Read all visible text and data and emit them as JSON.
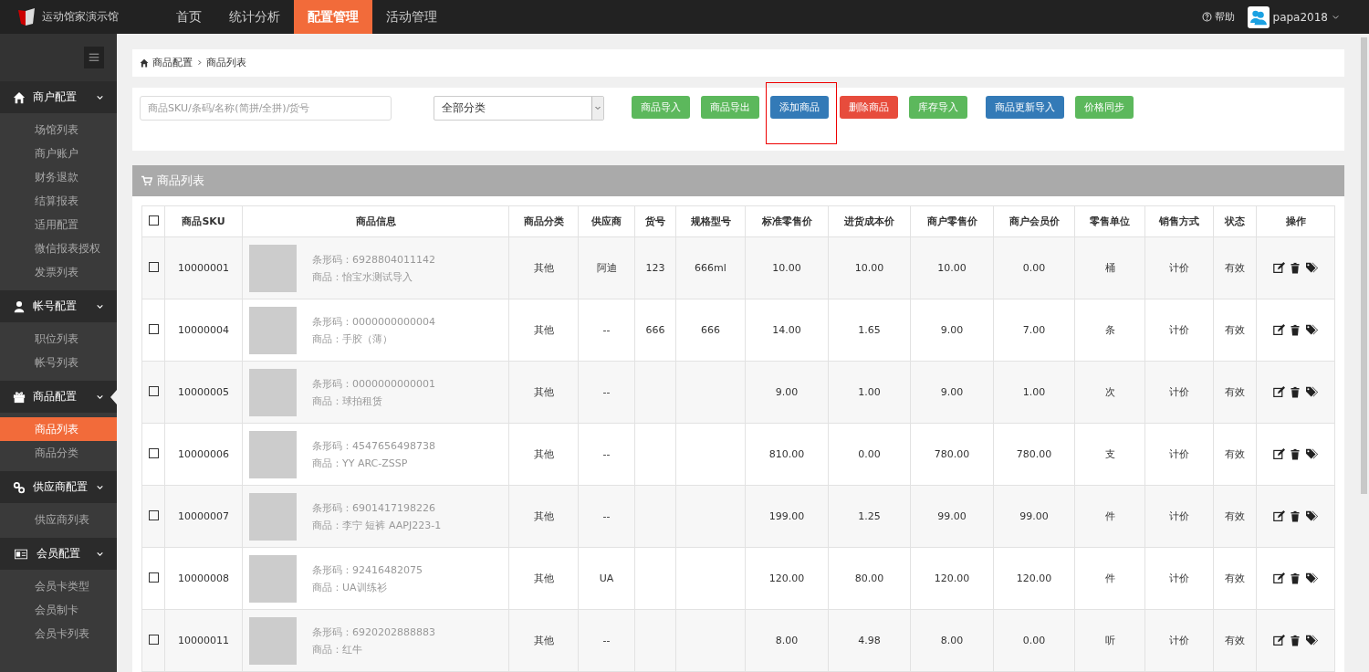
{
  "topbar": {
    "brand": "运动馆家演示馆",
    "nav": [
      {
        "label": "首页",
        "selected": false
      },
      {
        "label": "统计分析",
        "selected": false
      },
      {
        "label": "配置管理",
        "selected": true
      },
      {
        "label": "活动管理",
        "selected": false
      }
    ],
    "help": "帮助",
    "user": "papa2018"
  },
  "sidebar": {
    "groups": [
      {
        "label": "商户配置",
        "items": [
          {
            "label": "场馆列表",
            "selected": false
          },
          {
            "label": "商户账户",
            "selected": false
          },
          {
            "label": "财务退款",
            "selected": false
          },
          {
            "label": "结算报表",
            "selected": false
          },
          {
            "label": "适用配置",
            "selected": false
          },
          {
            "label": "微信报表授权",
            "selected": false
          },
          {
            "label": "发票列表",
            "selected": false
          }
        ]
      },
      {
        "label": "帐号配置",
        "items": [
          {
            "label": "职位列表",
            "selected": false
          },
          {
            "label": "帐号列表",
            "selected": false
          }
        ]
      },
      {
        "label": "商品配置",
        "items": [
          {
            "label": "商品列表",
            "selected": true
          },
          {
            "label": "商品分类",
            "selected": false
          }
        ]
      },
      {
        "label": "供应商配置",
        "items": [
          {
            "label": "供应商列表",
            "selected": false
          }
        ]
      },
      {
        "label": "会员配置",
        "items": [
          {
            "label": "会员卡类型",
            "selected": false
          },
          {
            "label": "会员制卡",
            "selected": false
          },
          {
            "label": "会员卡列表",
            "selected": false
          }
        ]
      }
    ]
  },
  "breadcrumb": [
    "商品配置",
    "商品列表"
  ],
  "toolbar": {
    "search": {
      "placeholder": "商品SKU/条码/名称(简拼/全拼)/货号"
    },
    "category_select": "全部分类",
    "buttons": [
      {
        "label": "商品导入",
        "kind": "success",
        "highlighted": false
      },
      {
        "label": "商品导出",
        "kind": "success",
        "highlighted": false
      },
      {
        "label": "添加商品",
        "kind": "primary",
        "highlighted": true
      },
      {
        "label": "删除商品",
        "kind": "danger",
        "highlighted": false
      },
      {
        "label": "库存导入",
        "kind": "success",
        "highlighted": false
      },
      {
        "label": "商品更新导入",
        "kind": "primary",
        "highlighted": false
      },
      {
        "label": "价格同步",
        "kind": "success",
        "highlighted": false
      }
    ]
  },
  "panel": {
    "title": "商品列表",
    "table": {
      "select_all_checked": false,
      "columns": [
        "商品SKU",
        "商品信息",
        "商品分类",
        "供应商",
        "货号",
        "规格型号",
        "标准零售价",
        "进货成本价",
        "商户零售价",
        "商户会员价",
        "零售单位",
        "销售方式",
        "状态",
        "操作"
      ],
      "rows": [
        {
          "checked": false,
          "sku": "10000001",
          "barcode": "条形码：6928804011142",
          "product": "商品：怡宝水测试导入",
          "category": "其他",
          "supplier": "阿迪",
          "item_no": "123",
          "spec": "666ml",
          "std_price": "10.00",
          "cost": "10.00",
          "retail": "10.00",
          "member": "0.00",
          "unit": "桶",
          "sale_mode": "计价",
          "status": "有效"
        },
        {
          "checked": false,
          "sku": "10000004",
          "barcode": "条形码：0000000000004",
          "product": "商品：手胶（薄）",
          "category": "其他",
          "supplier": "--",
          "item_no": "666",
          "spec": "666",
          "std_price": "14.00",
          "cost": "1.65",
          "retail": "9.00",
          "member": "7.00",
          "unit": "条",
          "sale_mode": "计价",
          "status": "有效"
        },
        {
          "checked": false,
          "sku": "10000005",
          "barcode": "条形码：0000000000001",
          "product": "商品：球拍租赁",
          "category": "其他",
          "supplier": "--",
          "item_no": "",
          "spec": "",
          "std_price": "9.00",
          "cost": "1.00",
          "retail": "9.00",
          "member": "1.00",
          "unit": "次",
          "sale_mode": "计价",
          "status": "有效"
        },
        {
          "checked": false,
          "sku": "10000006",
          "barcode": "条形码：4547656498738",
          "product": "商品：YY ARC-ZSSP",
          "category": "其他",
          "supplier": "--",
          "item_no": "",
          "spec": "",
          "std_price": "810.00",
          "cost": "0.00",
          "retail": "780.00",
          "member": "780.00",
          "unit": "支",
          "sale_mode": "计价",
          "status": "有效"
        },
        {
          "checked": false,
          "sku": "10000007",
          "barcode": "条形码：6901417198226",
          "product": "商品：李宁 短裤 AAPJ223-1",
          "category": "其他",
          "supplier": "--",
          "item_no": "",
          "spec": "",
          "std_price": "199.00",
          "cost": "1.25",
          "retail": "99.00",
          "member": "99.00",
          "unit": "件",
          "sale_mode": "计价",
          "status": "有效"
        },
        {
          "checked": false,
          "sku": "10000008",
          "barcode": "条形码：92416482075",
          "product": "商品：UA训练衫",
          "category": "其他",
          "supplier": "UA",
          "item_no": "",
          "spec": "",
          "std_price": "120.00",
          "cost": "80.00",
          "retail": "120.00",
          "member": "120.00",
          "unit": "件",
          "sale_mode": "计价",
          "status": "有效"
        },
        {
          "checked": false,
          "sku": "10000011",
          "barcode": "条形码：6920202888883",
          "product": "商品：红牛",
          "category": "其他",
          "supplier": "--",
          "item_no": "",
          "spec": "",
          "std_price": "8.00",
          "cost": "4.98",
          "retail": "8.00",
          "member": "0.00",
          "unit": "听",
          "sale_mode": "计价",
          "status": "有效"
        }
      ]
    }
  }
}
